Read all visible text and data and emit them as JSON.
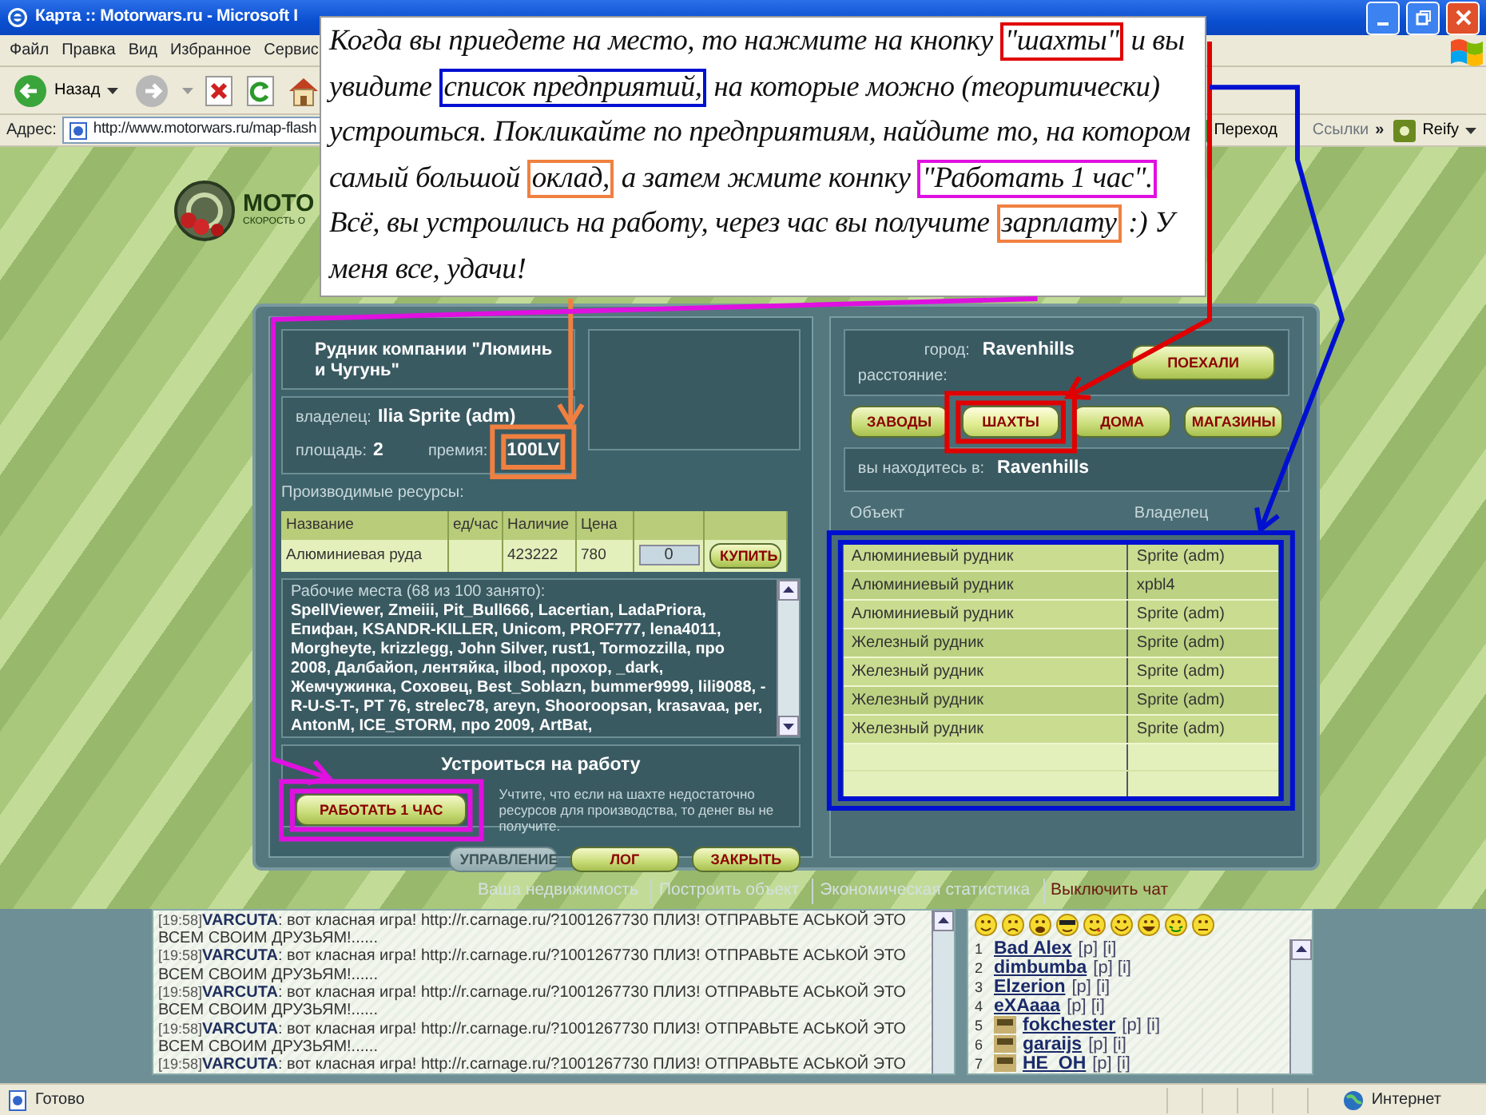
{
  "window": {
    "title": "Карта :: Motorwars.ru - Microsoft I"
  },
  "menu": [
    "Файл",
    "Правка",
    "Вид",
    "Избранное",
    "Сервис"
  ],
  "toolbar": {
    "back_label": "Назад"
  },
  "address_bar": {
    "label": "Адрес:",
    "url": "http://www.motorwars.ru/map-flash",
    "go_label": "Переход",
    "links_label": "Ссылки",
    "more": "»",
    "extension": "Reify"
  },
  "logo": {
    "name": "MOTO",
    "tagline": "СКОРОСТЬ О"
  },
  "annotation": {
    "segments": [
      {
        "text": "Когда вы приедете на место, то  нажмите на кнопку "
      },
      {
        "text": "\"шахты\"",
        "color": "#e00000"
      },
      {
        "text": " и вы увидите "
      },
      {
        "text": "список предприятий,",
        "color": "#0010d0"
      },
      {
        "text": " на которые можно (теоритически) устроиться. Покликайте по предприятиям, найдите то, на котором самый большой "
      },
      {
        "text": "оклад,",
        "color": "#f08040"
      },
      {
        "text": " а затем жмите конпку "
      },
      {
        "text": "\"Работать 1 час\".",
        "color": "#e010e0"
      },
      {
        "text": " Всё, вы устроились на работу, через час вы получите "
      },
      {
        "text": "зарплату",
        "color": "#f08040"
      },
      {
        "text": " :) У меня все, удачи!"
      }
    ]
  },
  "mine_panel": {
    "title": "Рудник компании \"Люминь и Чугунь\"",
    "owner_label": "владелец:",
    "owner": "Ilia Sprite (adm)",
    "area_label": "площадь:",
    "area": "2",
    "bonus_label": "премия:",
    "bonus": "100LV",
    "resources_label": "Производимые ресурсы:",
    "resources": {
      "columns": [
        "Название",
        "ед/час",
        "Наличие",
        "Цена"
      ],
      "rows": [
        {
          "name": "Алюминиевая руда",
          "stock": "423222",
          "price": "780",
          "amount": "0",
          "buy": "КУПИТЬ"
        }
      ]
    },
    "workers_title": "Рабочие места (68 из 100 занято):",
    "workers": "SpellViewer, Zmeiii, Pit_Bull666, Lacertian, LadaPriora, Епифан, KSANDR-KILLER, Unicom, PROF777, lena4011, Morgheyte, krizzlegg, John Silver, rust1, Tormozzilla, про 2008, Далбайоп, лентяйка, ilbod, прохор, _dark, Жемчужинка, Соховец, Best_Soblazn, bummer9999, lili9088, -R-U-S-T-, PT 76, strelec78, areyn, Shooroopsan, krasavaa, per, AntonM, ICE_STORM, про 2009, ArtBat,",
    "job_title": "Устроиться на работу",
    "work_button": "РАБОТАТЬ 1 ЧАС",
    "job_note": "Учтите, что если на шахте недостаточно ресурсов для производства, то денег вы не получите.",
    "buttons": [
      {
        "label": "УПРАВЛЕНИЕ",
        "disabled": true
      },
      {
        "label": "ЛОГ",
        "disabled": false
      },
      {
        "label": "ЗАКРЫТЬ",
        "disabled": false
      }
    ]
  },
  "city_panel": {
    "city_label": "город:",
    "city": "Ravenhills",
    "distance_label": "расстояние:",
    "go_button": "ПОЕХАЛИ",
    "tabs": [
      {
        "label": "ЗАВОДЫ",
        "selected": false
      },
      {
        "label": "ШАХТЫ",
        "selected": true
      },
      {
        "label": "ДОМА",
        "selected": false
      },
      {
        "label": "МАГАЗИНЫ",
        "selected": false
      }
    ],
    "location_label": "вы находитесь в:",
    "location": "Ravenhills",
    "table": {
      "columns": [
        "Объект",
        "Владелец"
      ],
      "rows": [
        [
          "Алюминиевый рудник",
          "Sprite (adm)"
        ],
        [
          "Алюминиевый рудник",
          "xpbl4"
        ],
        [
          "Алюминиевый рудник",
          "Sprite (adm)"
        ],
        [
          "Железный рудник",
          "Sprite (adm)"
        ],
        [
          "Железный рудник",
          "Sprite (adm)"
        ],
        [
          "Железный рудник",
          "Sprite (adm)"
        ],
        [
          "Железный рудник",
          "Sprite (adm)"
        ]
      ]
    }
  },
  "footer_links": [
    {
      "label": "Ваша недвижимость",
      "kind": "link"
    },
    {
      "label": "Построить объект",
      "kind": "link"
    },
    {
      "label": "Экономическая статистика",
      "kind": "link"
    },
    {
      "label": "Выключить чат",
      "kind": "toggle"
    }
  ],
  "chat": {
    "messages": [
      {
        "time": "[19:58]",
        "user": "VARCUTA",
        "text": ": вот класная игра! http://r.carnage.ru/?1001267730 ПЛИЗ! ОТПРАВЬТЕ АСЬКОЙ ЭТО ВСЕМ СВОИМ ДРУЗЬЯМ!......"
      },
      {
        "time": "[19:58]",
        "user": "VARCUTA",
        "text": ": вот класная игра! http://r.carnage.ru/?1001267730 ПЛИЗ! ОТПРАВЬТЕ АСЬКОЙ ЭТО ВСЕМ СВОИМ ДРУЗЬЯМ!......"
      },
      {
        "time": "[19:58]",
        "user": "VARCUTA",
        "text": ": вот класная игра! http://r.carnage.ru/?1001267730 ПЛИЗ! ОТПРАВЬТЕ АСЬКОЙ ЭТО ВСЕМ СВОИМ ДРУЗЬЯМ!......"
      },
      {
        "time": "[19:58]",
        "user": "VARCUTA",
        "text": ": вот класная игра! http://r.carnage.ru/?1001267730 ПЛИЗ! ОТПРАВЬТЕ АСЬКОЙ ЭТО ВСЕМ СВОИМ ДРУЗЬЯМ!......"
      },
      {
        "time": "[19:58]",
        "user": "VARCUTA",
        "text": ": вот класная игра! http://r.carnage.ru/?1001267730 ПЛИЗ! ОТПРАВЬТЕ АСЬКОЙ ЭТО"
      }
    ],
    "users": [
      {
        "number": "1",
        "name": "Bad Alex",
        "links": "[p] [i]",
        "has_icon": false
      },
      {
        "number": "2",
        "name": "dimbumba",
        "links": "[p] [i]",
        "has_icon": false
      },
      {
        "number": "3",
        "name": "Elzerion",
        "links": "[p] [i]",
        "has_icon": false
      },
      {
        "number": "4",
        "name": "eXAaaa",
        "links": "[p] [i]",
        "has_icon": false
      },
      {
        "number": "5",
        "name": "fokchester",
        "links": "[p] [i]",
        "has_icon": true
      },
      {
        "number": "6",
        "name": "garaijs",
        "links": "[p] [i]",
        "has_icon": true
      },
      {
        "number": "7",
        "name": "HE_OH",
        "links": "[p] [i]",
        "has_icon": true
      }
    ]
  },
  "status_bar": {
    "text": "Готово",
    "zone": "Интернет"
  }
}
